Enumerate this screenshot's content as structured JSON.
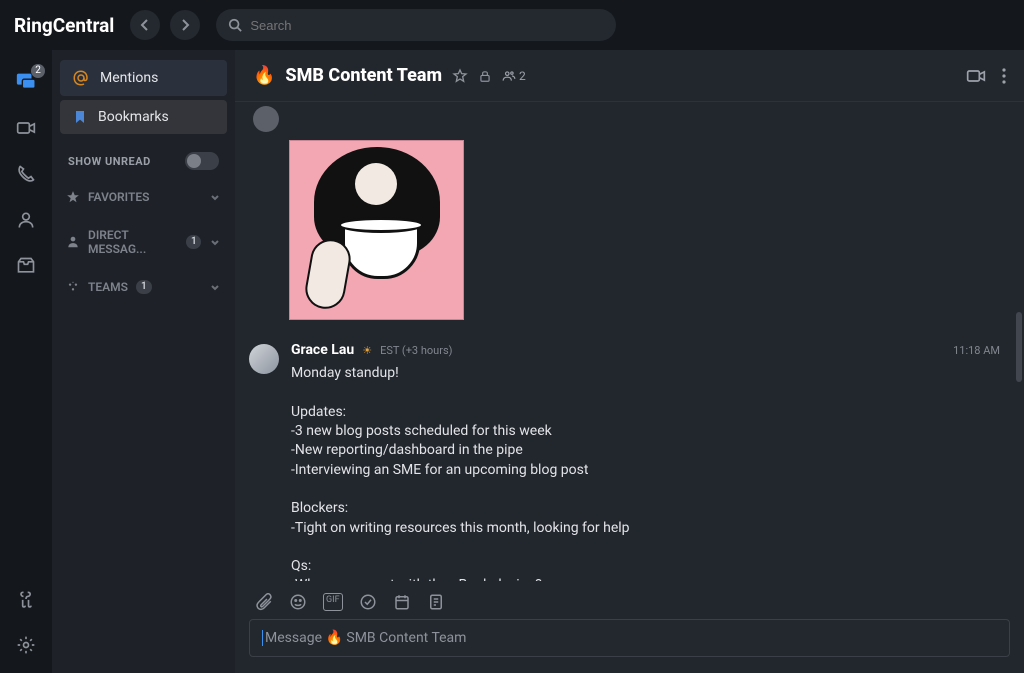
{
  "app": {
    "brand": "RingCentral"
  },
  "search": {
    "placeholder": "Search"
  },
  "rail": {
    "unread_badge": "2"
  },
  "sidebar": {
    "mentions_label": "Mentions",
    "bookmarks_label": "Bookmarks",
    "show_unread_label": "SHOW UNREAD",
    "favorites_label": "FAVORITES",
    "dm_label": "DIRECT MESSAG...",
    "dm_count": "1",
    "teams_label": "TEAMS",
    "teams_count": "1"
  },
  "channel": {
    "emoji": "🔥",
    "name": "SMB Content Team",
    "member_count": "2"
  },
  "message": {
    "author": "Grace Lau",
    "timezone": "EST (+3 hours)",
    "time": "11:18 AM",
    "body": "Monday standup!\n\nUpdates:\n-3 new blog posts scheduled for this week\n-New reporting/dashboard in the pipe\n-Interviewing an SME for an upcoming blog post\n\nBlockers:\n-Tight on writing resources this month, looking for help\n\nQs:\n-Where are we at with the eBook design?"
  },
  "composer": {
    "placeholder": "Message 🔥 SMB Content Team"
  }
}
